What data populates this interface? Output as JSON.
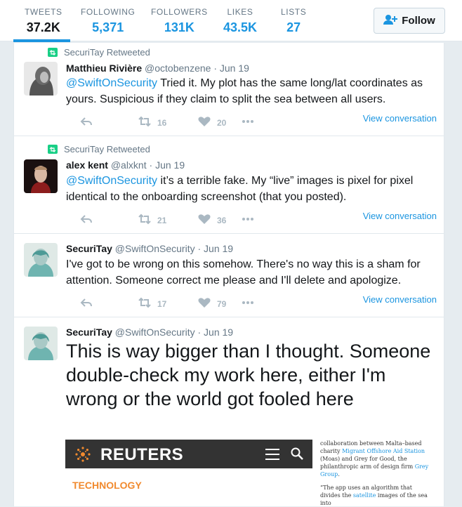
{
  "nav": {
    "stats": [
      {
        "label": "TWEETS",
        "value": "37.2K"
      },
      {
        "label": "FOLLOWING",
        "value": "5,371"
      },
      {
        "label": "FOLLOWERS",
        "value": "131K"
      },
      {
        "label": "LIKES",
        "value": "43.5K"
      },
      {
        "label": "LISTS",
        "value": "27"
      }
    ],
    "follow_label": "Follow",
    "active_tab": "TWEETS"
  },
  "tweets": [
    {
      "context": "SecuriTay Retweeted",
      "name": "Matthieu Rivière",
      "handle": "@octobenzene",
      "dot": "·",
      "time": "Jun 19",
      "mention": "@SwiftOnSecurity",
      "text": " Tried it. My plot has the same long/lat coordinates as yours. Suspicious if they claim to split the sea between all users.",
      "retweets": "16",
      "likes": "20",
      "view_conversation": "View conversation"
    },
    {
      "context": "SecuriTay Retweeted",
      "name": "alex kent",
      "handle": "@alxknt",
      "dot": "·",
      "time": "Jun 19",
      "mention": "@SwiftOnSecurity",
      "text": " it’s a terrible fake. My “live” images is pixel for pixel identical to the onboarding screenshot (that you posted).",
      "retweets": "21",
      "likes": "36",
      "view_conversation": "View conversation"
    },
    {
      "name": "SecuriTay",
      "handle": "@SwiftOnSecurity",
      "dot": "·",
      "time": "Jun 19",
      "text": "I've got to be wrong on this somehow. There's no way this is a sham for attention. Someone correct me please and I'll delete and apologize.",
      "retweets": "17",
      "likes": "79",
      "view_conversation": "View conversation"
    },
    {
      "name": "SecuriTay",
      "handle": "@SwiftOnSecurity",
      "dot": "·",
      "time": "Jun 19",
      "text": "This is way bigger than I thought. Someone double-check my work here, either I'm wrong or the world got fooled here"
    }
  ],
  "embed": {
    "brand": "REUTERS",
    "section": "TECHNOLOGY",
    "p1_a": "collaboration between Malta–based charity ",
    "p1_link1": "Migrant Offshore Aid Station",
    "p1_b": " (Moas) and Grey for Good, the philanthropic arm of design firm ",
    "p1_link2": "Grey Group",
    "p1_c": ".",
    "p2_a": "“The app uses an algorithm that divides the ",
    "p2_link": "satellite",
    "p2_b": " images of the sea into"
  },
  "colors": {
    "accent": "#1b95e0",
    "retweet_green": "#19cf86",
    "muted": "#657786",
    "action_gray": "#aab8c2",
    "news_orange": "#f18a2e"
  }
}
